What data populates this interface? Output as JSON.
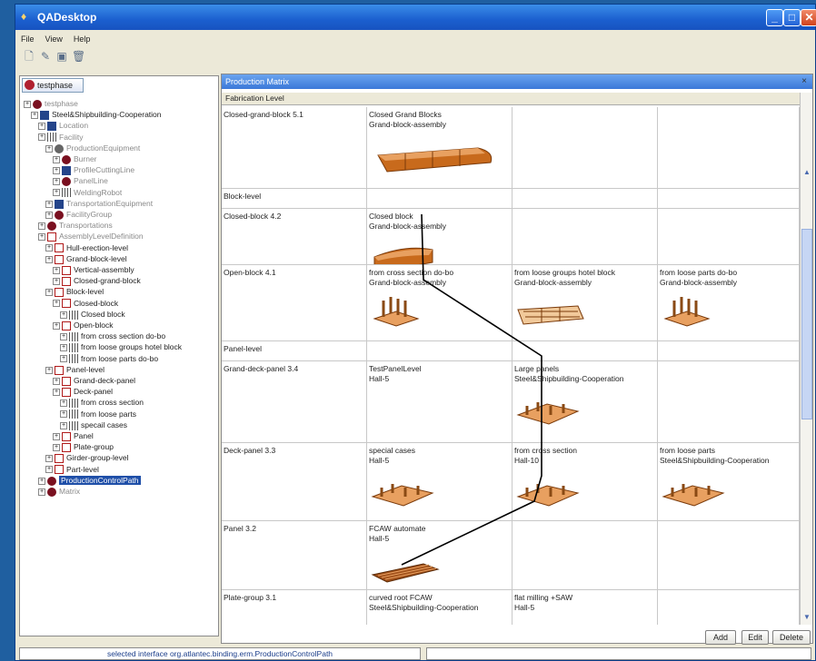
{
  "window": {
    "title": "QADesktop"
  },
  "menu": [
    "File",
    "View",
    "Help"
  ],
  "left_tab": "testphase",
  "tree": [
    {
      "label": "testphase",
      "indent": 0,
      "gray": true,
      "icon": "red"
    },
    {
      "label": "Steel&Shipbuilding-Cooperation",
      "indent": 1,
      "icon": "blue"
    },
    {
      "label": "Location",
      "indent": 2,
      "gray": true,
      "icon": "blue"
    },
    {
      "label": "Facility",
      "indent": 2,
      "gray": true,
      "icon": "grid"
    },
    {
      "label": "ProductionEquipment",
      "indent": 3,
      "gray": true,
      "icon": "gear"
    },
    {
      "label": "Burner",
      "indent": 4,
      "gray": true,
      "icon": "red"
    },
    {
      "label": "ProfileCuttingLine",
      "indent": 4,
      "gray": true,
      "icon": "blue"
    },
    {
      "label": "PanelLine",
      "indent": 4,
      "gray": true,
      "icon": "red"
    },
    {
      "label": "WeldingRobot",
      "indent": 4,
      "gray": true,
      "icon": "grid"
    },
    {
      "label": "TransportationEquipment",
      "indent": 3,
      "gray": true,
      "icon": "blue"
    },
    {
      "label": "FacilityGroup",
      "indent": 3,
      "gray": true,
      "icon": "red"
    },
    {
      "label": "Transportations",
      "indent": 2,
      "gray": true,
      "icon": "red"
    },
    {
      "label": "AssemblyLevelDefinition",
      "indent": 2,
      "gray": true,
      "icon": "lvl"
    },
    {
      "label": "Hull-erection-level",
      "indent": 3,
      "icon": "lvl"
    },
    {
      "label": "Grand-block-level",
      "indent": 3,
      "icon": "lvl"
    },
    {
      "label": "Vertical-assembly",
      "indent": 4,
      "icon": "lvl"
    },
    {
      "label": "Closed-grand-block",
      "indent": 4,
      "icon": "lvl"
    },
    {
      "label": "Block-level",
      "indent": 3,
      "icon": "lvl"
    },
    {
      "label": "Closed-block",
      "indent": 4,
      "icon": "lvl"
    },
    {
      "label": "Closed block",
      "indent": 5,
      "icon": "grid"
    },
    {
      "label": "Open-block",
      "indent": 4,
      "icon": "lvl"
    },
    {
      "label": "from cross section do-bo",
      "indent": 5,
      "icon": "grid"
    },
    {
      "label": "from loose groups hotel block",
      "indent": 5,
      "icon": "grid"
    },
    {
      "label": "from loose parts do-bo",
      "indent": 5,
      "icon": "grid"
    },
    {
      "label": "Panel-level",
      "indent": 3,
      "icon": "lvl"
    },
    {
      "label": "Grand-deck-panel",
      "indent": 4,
      "icon": "lvl"
    },
    {
      "label": "Deck-panel",
      "indent": 4,
      "icon": "lvl"
    },
    {
      "label": "from cross section",
      "indent": 5,
      "icon": "grid"
    },
    {
      "label": "from loose parts",
      "indent": 5,
      "icon": "grid"
    },
    {
      "label": "specail cases",
      "indent": 5,
      "icon": "grid"
    },
    {
      "label": "Panel",
      "indent": 4,
      "icon": "lvl"
    },
    {
      "label": "Plate-group",
      "indent": 4,
      "icon": "lvl"
    },
    {
      "label": "Girder-group-level",
      "indent": 3,
      "icon": "lvl"
    },
    {
      "label": "Part-level",
      "indent": 3,
      "icon": "lvl"
    },
    {
      "label": "ProductionControlPath",
      "indent": 2,
      "selected": true,
      "icon": "red"
    },
    {
      "label": "Matrix",
      "indent": 2,
      "gray": true,
      "icon": "red"
    }
  ],
  "matrix": {
    "title": "Production Matrix",
    "header": "Fabrication Level",
    "rows": [
      {
        "level": "Closed-grand-block 5.1",
        "h": 90,
        "cells": [
          {
            "l1": "Closed Grand Blocks",
            "l2": "Grand-block-assembly",
            "img": "grand"
          },
          null,
          null
        ]
      },
      {
        "level": "Block-level",
        "h": 22,
        "group": true,
        "cells": [
          null,
          null,
          null
        ]
      },
      {
        "level": "Closed-block 4.2",
        "h": 62,
        "cells": [
          {
            "l1": "Closed block",
            "l2": "Grand-block-assembly",
            "img": "closed"
          },
          null,
          null
        ]
      },
      {
        "level": "Open-block 4.1",
        "h": 84,
        "cells": [
          {
            "l1": "from cross section do-bo",
            "l2": "Grand-block-assembly",
            "img": "open"
          },
          {
            "l1": "from loose groups hotel block",
            "l2": "Grand-block-assembly",
            "img": "hotel"
          },
          {
            "l1": "from loose parts do-bo",
            "l2": "Grand-block-assembly",
            "img": "open"
          }
        ]
      },
      {
        "level": "Panel-level",
        "h": 22,
        "group": true,
        "cells": [
          null,
          null,
          null
        ]
      },
      {
        "level": "Grand-deck-panel 3.4",
        "h": 90,
        "cells": [
          {
            "l1": "TestPanelLevel",
            "l2": "Hall-5",
            "img": null
          },
          {
            "l1": "Large panels",
            "l2": "Steel&Shipbuilding-Cooperation",
            "img": "deck"
          },
          null
        ]
      },
      {
        "level": "Deck-panel 3.3",
        "h": 86,
        "cells": [
          {
            "l1": "special cases",
            "l2": "Hall-5",
            "img": "deck"
          },
          {
            "l1": "from cross section",
            "l2": "Hall-10",
            "img": "deck"
          },
          {
            "l1": "from loose parts",
            "l2": "Steel&Shipbuilding-Cooperation",
            "img": "deck"
          }
        ]
      },
      {
        "level": "Panel 3.2",
        "h": 76,
        "cells": [
          {
            "l1": "FCAW automate",
            "l2": "Hall-5",
            "img": "panel"
          },
          null,
          null
        ]
      },
      {
        "level": "Plate-group 3.1",
        "h": 40,
        "cells": [
          {
            "l1": "curved root FCAW",
            "l2": "Steel&Shipbuilding-Cooperation",
            "img": null
          },
          {
            "l1": "flat milling +SAW",
            "l2": "Hall-5",
            "img": null
          },
          null
        ]
      }
    ]
  },
  "buttons": {
    "add": "Add",
    "edit": "Edit",
    "delete": "Delete"
  },
  "status": "selected interface org.atlantec.binding.erm.ProductionControlPath"
}
